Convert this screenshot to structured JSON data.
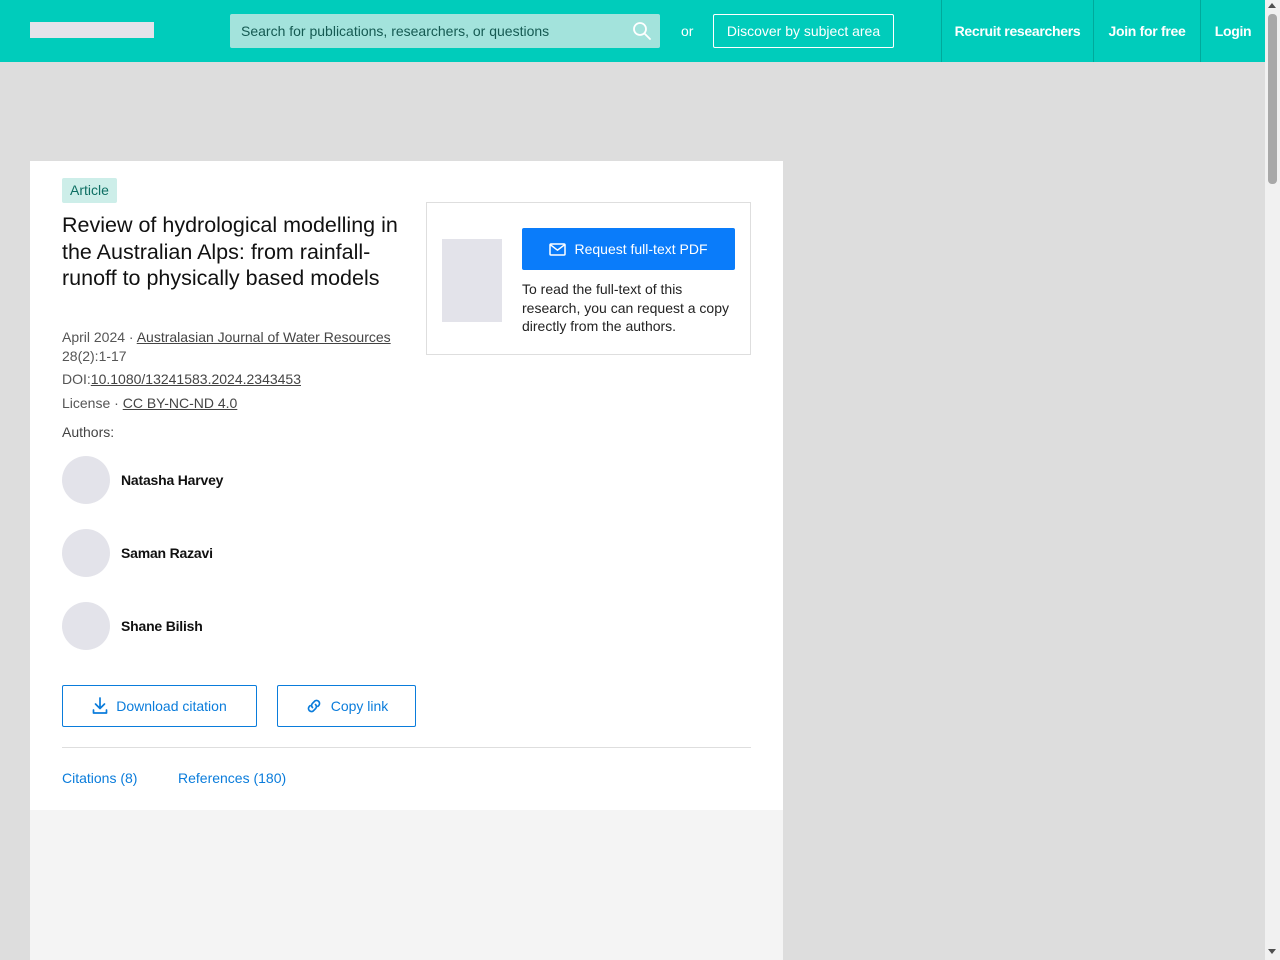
{
  "header": {
    "search_placeholder": "Search for publications, researchers, or questions",
    "or_text": "or",
    "discover_label": "Discover by subject area",
    "nav": {
      "recruit": "Recruit researchers",
      "join": "Join for free",
      "login": "Login"
    },
    "accent_color": "#00ccbb"
  },
  "article": {
    "badge": "Article",
    "title": "Review of hydrological modelling in the Australian Alps: from rainfall-runoff to physically based models",
    "date_prefix": "April 2024 · ",
    "journal": "Australasian Journal of Water Resources",
    "volume": "28(2):1-17",
    "doi_label": "DOI:",
    "doi": "10.1080/13241583.2024.2343453",
    "license_label": "License · ",
    "license": "CC BY-NC-ND 4.0",
    "authors_label": "Authors:",
    "authors": [
      {
        "name": "Natasha Harvey"
      },
      {
        "name": "Saman Razavi"
      },
      {
        "name": "Shane Bilish"
      }
    ],
    "download_citation": "Download citation",
    "copy_link": "Copy link",
    "tabs": {
      "citations": "Citations (8)",
      "references": "References (180)"
    }
  },
  "fulltext": {
    "button": "Request full-text PDF",
    "description": "To read the full-text of this research, you can request a copy directly from the authors."
  },
  "icons": {
    "search": "search-icon",
    "mail": "mail-icon",
    "download": "download-icon",
    "link": "link-icon"
  }
}
